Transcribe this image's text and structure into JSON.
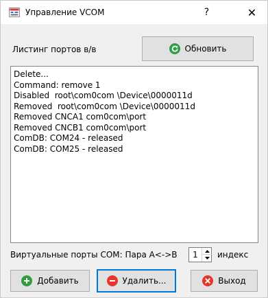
{
  "window": {
    "title": "Управление VCOM",
    "help_glyph": "?",
    "close_glyph": "✕"
  },
  "header": {
    "list_label": "Листинг портов в/в",
    "refresh_label": "Обновить"
  },
  "log": {
    "lines": [
      "Delete...",
      "Command: remove 1",
      "Disabled  root\\com0com \\Device\\0000011d",
      "Removed  root\\com0com \\Device\\0000011d",
      "Removed CNCA1 com0com\\port",
      "Removed CNCB1 com0com\\port",
      "ComDB: COM24 - released",
      "ComDB: COM25 - released"
    ]
  },
  "ports": {
    "label": "Виртуальные порты  COM: Пара A<->B",
    "index_value": "1",
    "index_label": "индекс"
  },
  "actions": {
    "add_label": "Добавить",
    "delete_label": "Удалить...",
    "exit_label": "Выход"
  },
  "colors": {
    "refresh_icon": "#2ea043",
    "add_icon": "#2e9e3e",
    "delete_icon": "#e8352c",
    "exit_icon": "#e8352c",
    "focus_border": "#0078d7"
  }
}
